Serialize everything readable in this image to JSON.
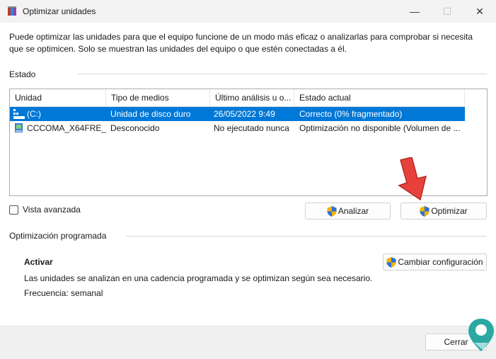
{
  "window": {
    "title": "Optimizar unidades",
    "minimize": "—",
    "maximize": "☐",
    "close": "✕"
  },
  "description": "Puede optimizar las unidades para que el equipo funcione de un modo más eficaz o analizarlas para comprobar si necesita que se optimicen. Solo se muestran las unidades del equipo o que estén conectadas a él.",
  "status": {
    "label": "Estado",
    "columns": [
      "Unidad",
      "Tipo de medios",
      "Último análisis u o...",
      "Estado actual"
    ],
    "rows": [
      {
        "unit": "(C:)",
        "media": "Unidad de disco duro",
        "last": "26/05/2022 9:49",
        "state": "Correcto (0% fragmentado)",
        "icon": "hard-drive-icon",
        "selected": true
      },
      {
        "unit": "CCCOMA_X64FRE_...",
        "media": "Desconocido",
        "last": "No ejecutado nunca",
        "state": "Optimización no disponible (Volumen de ...",
        "icon": "disc-drive-icon",
        "selected": false
      }
    ]
  },
  "advanced_view": {
    "label": "Vista avanzada",
    "checked": false
  },
  "buttons": {
    "analyze": "Analizar",
    "optimize": "Optimizar"
  },
  "scheduled": {
    "label": "Optimización programada",
    "state": "Activar",
    "info": "Las unidades se analizan en una cadencia programada y se optimizan según sea necesario.",
    "frequency": "Frecuencia: semanal",
    "change_button": "Cambiar configuración"
  },
  "footer": {
    "close_button": "Cerrar"
  },
  "colors": {
    "selection": "#0078d7",
    "annotation_arrow": "#e8413c"
  }
}
